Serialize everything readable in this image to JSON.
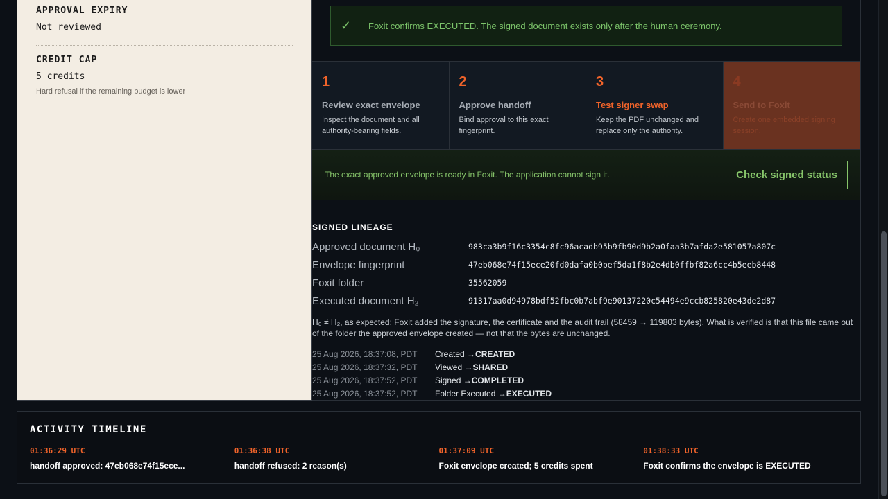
{
  "left_panel": {
    "approval_expiry": {
      "label": "APPROVAL EXPIRY",
      "value": "Not reviewed"
    },
    "credit_cap": {
      "label": "CREDIT CAP",
      "value": "5 credits",
      "note": "Hard refusal if the remaining budget is lower"
    }
  },
  "confirm_banner": {
    "icon": "check-icon",
    "text": "Foxit confirms EXECUTED. The signed document exists only after the human ceremony."
  },
  "steps": [
    {
      "number": "1",
      "title": "Review exact envelope",
      "desc": "Inspect the document and all authority-bearing fields."
    },
    {
      "number": "2",
      "title": "Approve handoff",
      "desc": "Bind approval to this exact fingerprint."
    },
    {
      "number": "3",
      "title": "Test signer swap",
      "desc": "Keep the PDF unchanged and replace only the authority."
    },
    {
      "number": "4",
      "title": "Send to Foxit",
      "desc": "Create one embedded signing session."
    }
  ],
  "ready_banner": {
    "text": "The exact approved envelope is ready in Foxit. The application cannot sign it.",
    "button": "Check signed status"
  },
  "lineage": {
    "title": "SIGNED LINEAGE",
    "rows": [
      {
        "key": "Approved document H₀",
        "value": "983ca3b9f16c3354c8fc96acadb95b9fb90d9b2a0faa3b7afda2e581057a807c"
      },
      {
        "key": "Envelope fingerprint",
        "value": "47eb068e74f15ece20fd0dafa0b0bef5da1f8b2e4db0ffbf82a6cc4b5eeb8448"
      },
      {
        "key": "Foxit folder",
        "value": "35562059"
      },
      {
        "key": "Executed document H₂",
        "value": "91317aa0d94978bdf52fbc0b7abf9e90137220c54494e9ccb825820e43de2d87"
      }
    ],
    "note": "H₀ ≠ H₂, as expected: Foxit added the signature, the certificate and the audit trail (58459 → 119803 bytes). What is verified is that this file came out of the folder the approved envelope created — not that the bytes are unchanged.",
    "events": [
      {
        "ts": "25 Aug 2026, 18:37:08, PDT",
        "label": "Created → ",
        "status": "CREATED"
      },
      {
        "ts": "25 Aug 2026, 18:37:32, PDT",
        "label": "Viewed → ",
        "status": "SHARED"
      },
      {
        "ts": "25 Aug 2026, 18:37:52, PDT",
        "label": "Signed → ",
        "status": "COMPLETED"
      },
      {
        "ts": "25 Aug 2026, 18:37:52, PDT",
        "label": "Folder Executed → ",
        "status": "EXECUTED"
      }
    ]
  },
  "timeline": {
    "title": "ACTIVITY TIMELINE",
    "items": [
      {
        "time": "01:36:29 UTC",
        "text": "handoff approved: 47eb068e74f15ece..."
      },
      {
        "time": "01:36:38 UTC",
        "text": "handoff refused: 2 reason(s)"
      },
      {
        "time": "01:37:09 UTC",
        "text": "Foxit envelope created; 5 credits spent"
      },
      {
        "time": "01:38:33 UTC",
        "text": "Foxit confirms the envelope is EXECUTED"
      }
    ]
  }
}
